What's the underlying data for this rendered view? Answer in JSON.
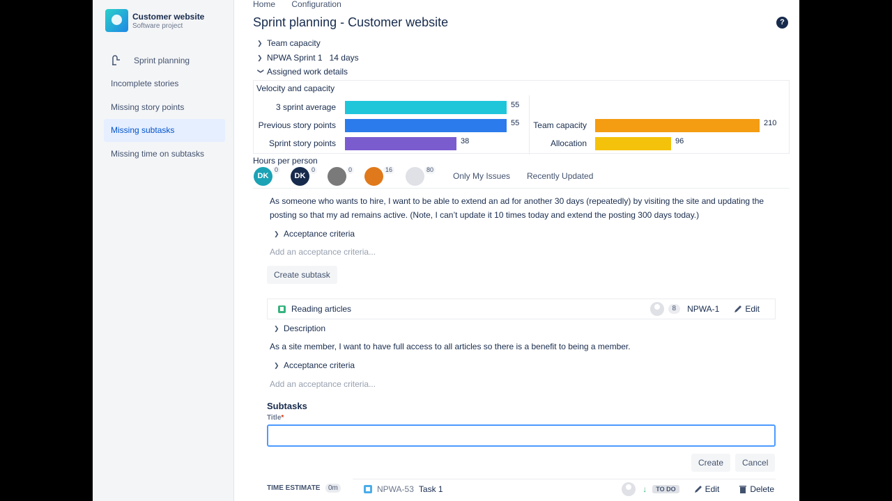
{
  "project": {
    "name": "Customer website",
    "subtitle": "Software project"
  },
  "sidebar": {
    "items": [
      {
        "label": "Sprint planning",
        "icon": "sprint-icon"
      },
      {
        "label": "Incomplete stories"
      },
      {
        "label": "Missing story points"
      },
      {
        "label": "Missing subtasks",
        "active": true
      },
      {
        "label": "Missing time on subtasks"
      }
    ]
  },
  "breadcrumb": {
    "home": "Home",
    "config": "Configuration"
  },
  "page": {
    "title": "Sprint planning - Customer website"
  },
  "expanders": {
    "team_capacity": "Team capacity",
    "sprint_name": "NPWA Sprint 1",
    "sprint_days": "14 days",
    "assigned": "Assigned work details"
  },
  "velocity": {
    "title": "Velocity and capacity",
    "left": [
      {
        "label": "3 sprint average",
        "value": "55",
        "fraction": 0.8,
        "color": "#1fc6da"
      },
      {
        "label": "Previous story points",
        "value": "55",
        "fraction": 0.8,
        "color": "#2b7bec"
      },
      {
        "label": "Sprint story points",
        "value": "38",
        "fraction": 0.55,
        "color": "#7b5ccf"
      }
    ],
    "right": [
      {
        "label": "Team capacity",
        "value": "210",
        "fraction": 1.0,
        "color": "#f49c12"
      },
      {
        "label": "Allocation",
        "value": "96",
        "fraction": 0.46,
        "color": "#f5c20b"
      }
    ]
  },
  "hours": {
    "label": "Hours per person",
    "people": [
      {
        "initials": "DK",
        "count": "0",
        "color": "#1ba2b5"
      },
      {
        "initials": "DK",
        "count": "0",
        "color": "#172b4d"
      },
      {
        "initials": "",
        "count": "0",
        "color": "#7a7a7a"
      },
      {
        "initials": "",
        "count": "16",
        "color": "#e0791b"
      },
      {
        "initials": "",
        "count": "80",
        "color": "#dfe1e6"
      }
    ],
    "only_my": "Only My Issues",
    "recent": "Recently Updated"
  },
  "story1": {
    "description": "As someone who wants to hire, I want to be able to extend an ad for another 30 days (repeatedly) by visiting the site and updating the posting so that my ad remains active. (Note, I can’t update it 10 times today and extend the posting 300 days today.)",
    "acceptance": "Acceptance criteria",
    "add_acceptance": "Add an acceptance criteria...",
    "create_subtask": "Create subtask"
  },
  "story2": {
    "title": "Reading articles",
    "points": "8",
    "key": "NPWA-1",
    "edit": "Edit",
    "description_label": "Description",
    "description": "As a site member, I want to have full access to all articles so there is a benefit to being a member.",
    "acceptance": "Acceptance criteria",
    "add_acceptance": "Add an acceptance criteria..."
  },
  "subtasks": {
    "heading": "Subtasks",
    "title_label": "Title",
    "title_value": "",
    "create": "Create",
    "cancel": "Cancel",
    "time_estimate_label": "TIME ESTIMATE",
    "time_estimate_value": "0m",
    "task": {
      "key": "NPWA-53",
      "name": "Task 1",
      "status": "TO DO",
      "edit": "Edit",
      "delete": "Delete"
    }
  }
}
